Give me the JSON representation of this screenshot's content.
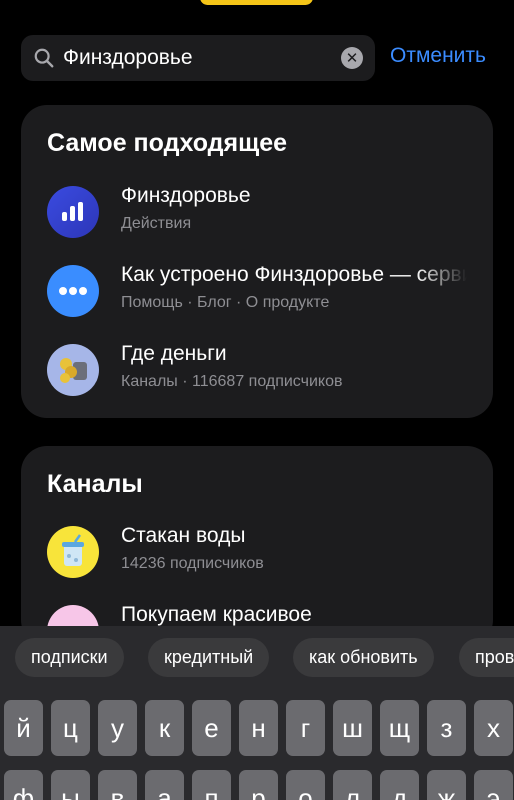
{
  "search": {
    "value": "Финздоровье",
    "cancel_label": "Отменить"
  },
  "best_match": {
    "title": "Самое подходящее",
    "items": [
      {
        "title": "Финздоровье",
        "subtitle": "Действия"
      },
      {
        "title": "Как устроено Финздоровье — сервис",
        "subtitle": "Помощь · Блог · О продукте"
      },
      {
        "title": "Где деньги",
        "subtitle": "Каналы · 116687 подписчиков"
      }
    ]
  },
  "channels": {
    "title": "Каналы",
    "items": [
      {
        "title": "Стакан воды",
        "subtitle": "14236 подписчиков"
      },
      {
        "title": "Покупаем красивое",
        "subtitle": ""
      }
    ]
  },
  "suggestions": [
    "подписки",
    "кредитный",
    "как обновить",
    "проверка"
  ],
  "keyboard": {
    "row1": [
      "й",
      "ц",
      "у",
      "к",
      "е",
      "н",
      "г",
      "ш",
      "щ",
      "з",
      "х"
    ],
    "row2": [
      "ф",
      "ы",
      "в",
      "а",
      "п",
      "р",
      "о",
      "л",
      "д",
      "ж",
      "э"
    ]
  },
  "colors": {
    "accent": "#3b8cff",
    "card": "#1c1c1e",
    "highlight": "#f5c518"
  }
}
